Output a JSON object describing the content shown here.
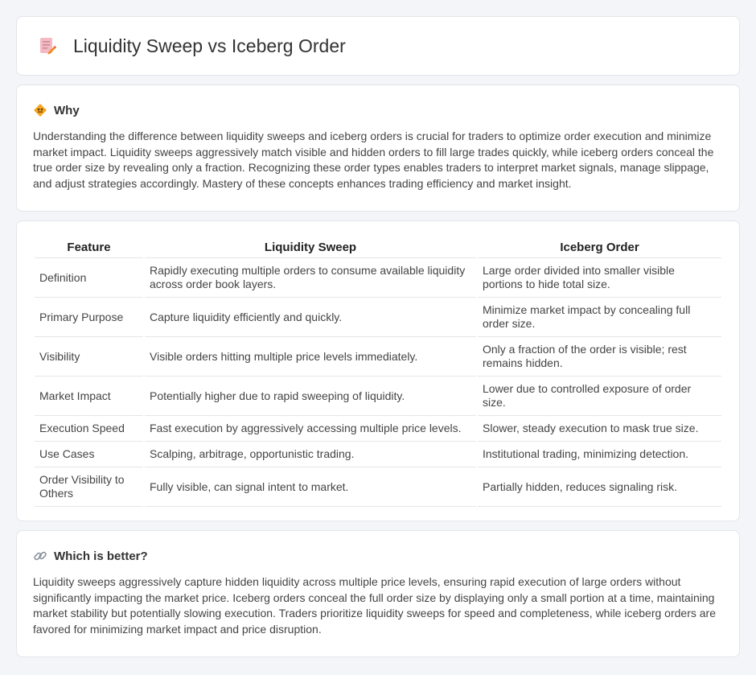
{
  "header": {
    "title": "Liquidity Sweep vs Iceberg Order",
    "icon": "document-edit-icon"
  },
  "why": {
    "icon": "diamond-sign-icon",
    "title": "Why",
    "text": "Understanding the difference between liquidity sweeps and iceberg orders is crucial for traders to optimize order execution and minimize market impact. Liquidity sweeps aggressively match visible and hidden orders to fill large trades quickly, while iceberg orders conceal the true order size by revealing only a fraction. Recognizing these order types enables traders to interpret market signals, manage slippage, and adjust strategies accordingly. Mastery of these concepts enhances trading efficiency and market insight."
  },
  "table": {
    "headers": [
      "Feature",
      "Liquidity Sweep",
      "Iceberg Order"
    ],
    "rows": [
      [
        "Definition",
        "Rapidly executing multiple orders to consume available liquidity across order book layers.",
        "Large order divided into smaller visible portions to hide total size."
      ],
      [
        "Primary Purpose",
        "Capture liquidity efficiently and quickly.",
        "Minimize market impact by concealing full order size."
      ],
      [
        "Visibility",
        "Visible orders hitting multiple price levels immediately.",
        "Only a fraction of the order is visible; rest remains hidden."
      ],
      [
        "Market Impact",
        "Potentially higher due to rapid sweeping of liquidity.",
        "Lower due to controlled exposure of order size."
      ],
      [
        "Execution Speed",
        "Fast execution by aggressively accessing multiple price levels.",
        "Slower, steady execution to mask true size."
      ],
      [
        "Use Cases",
        "Scalping, arbitrage, opportunistic trading.",
        "Institutional trading, minimizing detection."
      ],
      [
        "Order Visibility to Others",
        "Fully visible, can signal intent to market.",
        "Partially hidden, reduces signaling risk."
      ]
    ]
  },
  "better": {
    "icon": "link-icon",
    "title": "Which is better?",
    "text": "Liquidity sweeps aggressively capture hidden liquidity across multiple price levels, ensuring rapid execution of large orders without significantly impacting the market price. Iceberg orders conceal the full order size by displaying only a small portion at a time, maintaining market stability but potentially slowing execution. Traders prioritize liquidity sweeps for speed and completeness, while iceberg orders are favored for minimizing market impact and price disruption."
  }
}
